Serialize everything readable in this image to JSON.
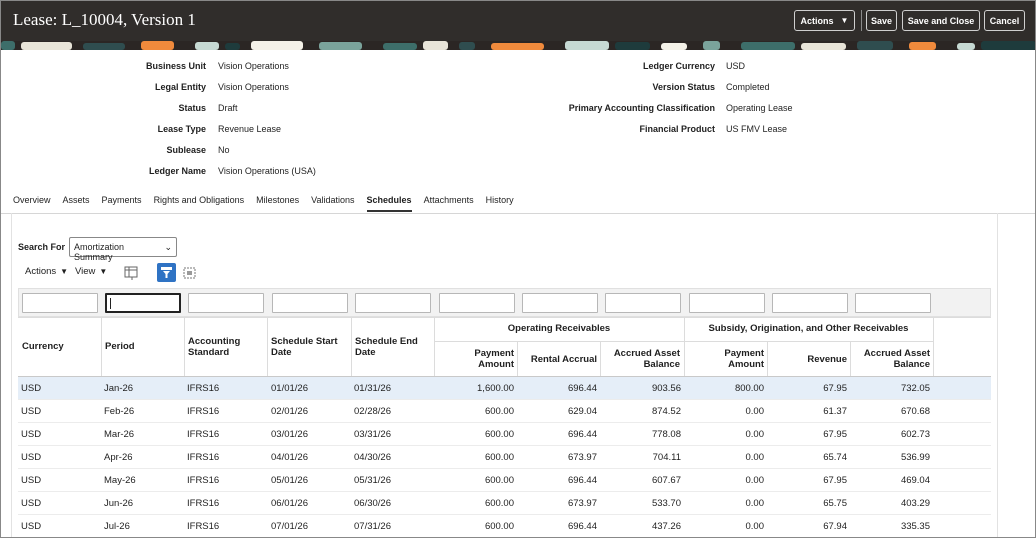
{
  "header": {
    "title": "Lease: L_10004, Version 1",
    "actions_label": "Actions",
    "save_label": "Save",
    "save_close_label": "Save and Close",
    "cancel_label": "Cancel"
  },
  "fields_left": [
    {
      "label": "Business Unit",
      "value": "Vision Operations"
    },
    {
      "label": "Legal Entity",
      "value": "Vision Operations"
    },
    {
      "label": "Status",
      "value": "Draft"
    },
    {
      "label": "Lease Type",
      "value": "Revenue Lease"
    },
    {
      "label": "Sublease",
      "value": "No"
    },
    {
      "label": "Ledger Name",
      "value": "Vision Operations (USA)"
    }
  ],
  "fields_right": [
    {
      "label": "Ledger Currency",
      "value": "USD"
    },
    {
      "label": "Version Status",
      "value": "Completed"
    },
    {
      "label": "Primary Accounting Classification",
      "value": "Operating Lease"
    },
    {
      "label": "Financial Product",
      "value": "US FMV Lease"
    }
  ],
  "tabs": [
    "Overview",
    "Assets",
    "Payments",
    "Rights and Obligations",
    "Milestones",
    "Validations",
    "Schedules",
    "Attachments",
    "History"
  ],
  "active_tab": "Schedules",
  "search": {
    "label": "Search For",
    "value": "Amortization Summary"
  },
  "toolbar": {
    "actions_label": "Actions",
    "view_label": "View"
  },
  "table": {
    "headers": {
      "currency": "Currency",
      "period": "Period",
      "standard": "Accounting Standard",
      "start": "Schedule Start Date",
      "end": "Schedule End Date",
      "group1": "Operating Receivables",
      "payment1": "Payment Amount",
      "rental": "Rental Accrual",
      "accrued1": "Accrued Asset Balance",
      "group2": "Subsidy, Origination, and Other Receivables",
      "payment2": "Payment Amount",
      "revenue": "Revenue",
      "accrued2": "Accrued Asset Balance"
    },
    "rows": [
      [
        "USD",
        "Jan-26",
        "IFRS16",
        "01/01/26",
        "01/31/26",
        "1,600.00",
        "696.44",
        "903.56",
        "800.00",
        "67.95",
        "732.05"
      ],
      [
        "USD",
        "Feb-26",
        "IFRS16",
        "02/01/26",
        "02/28/26",
        "600.00",
        "629.04",
        "874.52",
        "0.00",
        "61.37",
        "670.68"
      ],
      [
        "USD",
        "Mar-26",
        "IFRS16",
        "03/01/26",
        "03/31/26",
        "600.00",
        "696.44",
        "778.08",
        "0.00",
        "67.95",
        "602.73"
      ],
      [
        "USD",
        "Apr-26",
        "IFRS16",
        "04/01/26",
        "04/30/26",
        "600.00",
        "673.97",
        "704.11",
        "0.00",
        "65.74",
        "536.99"
      ],
      [
        "USD",
        "May-26",
        "IFRS16",
        "05/01/26",
        "05/31/26",
        "600.00",
        "696.44",
        "607.67",
        "0.00",
        "67.95",
        "469.04"
      ],
      [
        "USD",
        "Jun-26",
        "IFRS16",
        "06/01/26",
        "06/30/26",
        "600.00",
        "673.97",
        "533.70",
        "0.00",
        "65.75",
        "403.29"
      ],
      [
        "USD",
        "Jul-26",
        "IFRS16",
        "07/01/26",
        "07/31/26",
        "600.00",
        "696.44",
        "437.26",
        "0.00",
        "67.94",
        "335.35"
      ]
    ]
  },
  "colors": {
    "header_bg": "#302d2b",
    "selected_row": "#e5eef8",
    "accent_blue": "#2f73c4"
  }
}
